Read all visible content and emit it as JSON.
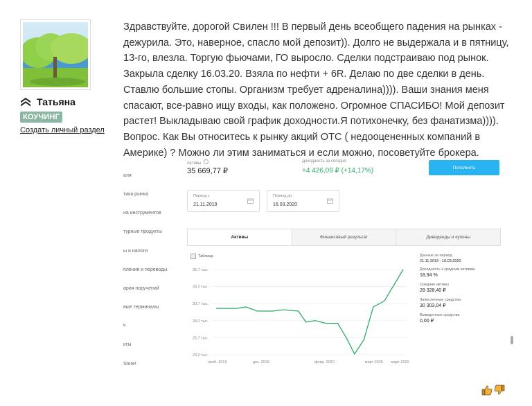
{
  "user": {
    "name": "Татьяна",
    "badge": "КОУЧИНГ",
    "profile_link": "Создать личный раздел"
  },
  "message": "Здравствуйте, дорогой Свилен !!!  В первый день всеобщего падения на рынках - дежурила. Это, наверное, спасло мой депозит)). Долго не выдержала и в пятницу, 13-го, влезла. Торгую фьючами, ГО выросло. Сделки подстраиваю под рынок. Закрыла сделку 16.03.20. Взяла по нефти + 6R. Делаю по две сделки в день. Ставлю большие стопы. Организм требует адреналина)))). Ваши знания меня спасают, все-равно ищу входы, как положено. Огромное СПАСИБО! Мой депозит растет! Выкладываю свой график доходности.Я потихонечку, без фанатизма)))). Вопрос. Как Вы относитесь к рынку акций ОТС ( недооцененных компаний в Америке) ? Можно ли этим заниматься и если можно, посоветуйте брокера.",
  "screenshot": {
    "nav": [
      "аля",
      "тика рынка",
      "на инструментов",
      "турные продукты",
      "ы и налоги",
      "пления и переводы",
      "ария поручений",
      "вые терминалы",
      "ь",
      "кты",
      "Store!"
    ],
    "assets_label": "Активы",
    "assets_value": "35 669,77 ₽",
    "today_label": "Доходность за сегодня",
    "today_value": "+4 426,09 ₽  (+14,17%)",
    "fund_button": "Пополнить",
    "period_from_label": "Период с",
    "period_from": "21.11.2019",
    "period_to_label": "Период до",
    "period_to": "16.03.2020",
    "tabs": [
      "Активы",
      "Финансовый результат",
      "Дивиденды и купоны"
    ],
    "table_toggle": "Таблица",
    "stats": [
      {
        "k": "Данные за период",
        "v": "21.11.2019 - 16.03.2020",
        "small": true
      },
      {
        "k": "Доходность к средним активам",
        "v": "18,94 %"
      },
      {
        "k": "Средние активы",
        "v": "28 328,40 ₽"
      },
      {
        "k": "Зачисленные средства",
        "v": "30 303,04 ₽"
      },
      {
        "k": "Выведенные средства",
        "v": "0,00 ₽"
      }
    ]
  },
  "chart_data": {
    "type": "line",
    "y_ticks": [
      "35,7 тыс.",
      "33,2 тыс.",
      "30,7 тыс.",
      "28,2 тыс.",
      "25,7 тыс.",
      "23,2 тыс."
    ],
    "ylim": [
      23.2,
      35.7
    ],
    "x_ticks": [
      "нояб. 2019",
      "дек. 2019",
      "февр. 2020",
      "март 2020",
      "март 2020"
    ],
    "x_tick_positions": [
      0,
      0.24,
      0.57,
      0.84,
      0.98
    ],
    "series": [
      {
        "color": "#2eab6a",
        "points": [
          [
            0.0,
            30.0
          ],
          [
            0.11,
            30.0
          ],
          [
            0.16,
            30.2
          ],
          [
            0.22,
            29.6
          ],
          [
            0.3,
            29.6
          ],
          [
            0.36,
            29.8
          ],
          [
            0.44,
            29.6
          ],
          [
            0.48,
            28.0
          ],
          [
            0.53,
            28.2
          ],
          [
            0.59,
            27.8
          ],
          [
            0.65,
            27.8
          ],
          [
            0.7,
            25.5
          ],
          [
            0.74,
            23.3
          ],
          [
            0.79,
            25.4
          ],
          [
            0.84,
            30.2
          ],
          [
            0.9,
            31.1
          ],
          [
            1.0,
            35.7
          ]
        ]
      }
    ]
  }
}
